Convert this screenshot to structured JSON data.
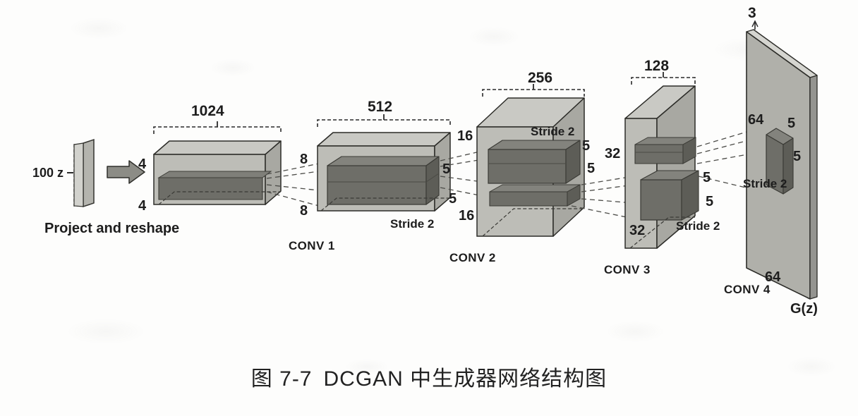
{
  "figure": {
    "caption_label": "图 7-7",
    "caption_title": "DCGAN 中生成器网络结构图",
    "colors": {
      "face_light": "#c9c9c4",
      "face_mid": "#b4b4ae",
      "face_dark": "#9d9d97",
      "kernel_light": "#8a8a84",
      "kernel_mid": "#74746e",
      "kernel_dark": "#5e5e58",
      "outline": "#2a2a2a",
      "background": "#fdfdfc",
      "text": "#1d1d1d"
    }
  },
  "input": {
    "latent_label": "100 z",
    "arrow_icon": "right-arrow-icon",
    "stage_label": "Project and reshape"
  },
  "stages": [
    {
      "id": "projected",
      "channels": "1024",
      "height_label": "4",
      "depth_label": "4",
      "stage_name": "",
      "stride": ""
    },
    {
      "id": "conv1",
      "channels": "512",
      "height_label": "8",
      "depth_label": "8",
      "kernel_h": "5",
      "kernel_w": "5",
      "stage_name": "CONV 1",
      "stride": "Stride 2"
    },
    {
      "id": "conv2",
      "channels": "256",
      "height_label": "16",
      "depth_label": "16",
      "kernel_h": "5",
      "kernel_w": "5",
      "stage_name": "CONV 2",
      "stride": "Stride 2"
    },
    {
      "id": "conv3",
      "channels": "128",
      "height_label": "32",
      "depth_label": "32",
      "kernel_h": "5",
      "kernel_w": "5",
      "stage_name": "CONV 3",
      "stride": "Stride 2"
    },
    {
      "id": "conv4",
      "channels": "3",
      "height_label": "64",
      "depth_label": "64",
      "kernel_h": "5",
      "kernel_w": "5",
      "stage_name": "CONV 4",
      "stride": "Stride 2"
    }
  ],
  "output": {
    "label": "G(z)"
  },
  "labels": {
    "ch_1024": "1024",
    "ch_512": "512",
    "ch_256": "256",
    "ch_128": "128",
    "ch_3": "3",
    "d4_a": "4",
    "d4_b": "4",
    "d8_a": "8",
    "d8_b": "8",
    "d16_a": "16",
    "d16_b": "16",
    "d32_a": "32",
    "d32_b": "32",
    "d64_a": "64",
    "d64_b": "64",
    "k5_c1_a": "5",
    "k5_c1_b": "5",
    "k5_c2_a": "5",
    "k5_c2_b": "5",
    "k5_c3_a": "5",
    "k5_c3_b": "5",
    "k5_c4_a": "5",
    "k5_c4_b": "5",
    "stride_c1": "Stride 2",
    "stride_c2": "Stride 2",
    "stride_c3": "Stride 2",
    "stride_c4": "Stride 2",
    "conv1": "CONV 1",
    "conv2": "CONV 2",
    "conv3": "CONV 3",
    "conv4": "CONV 4"
  }
}
